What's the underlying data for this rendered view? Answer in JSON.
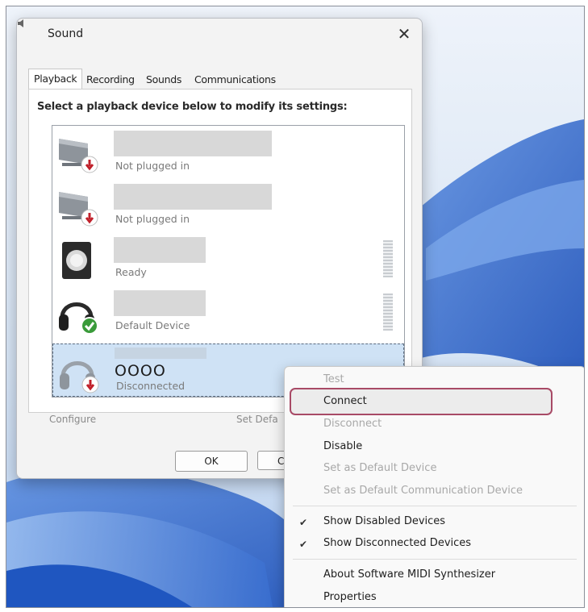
{
  "window": {
    "title": "Sound",
    "close_glyph": "✕"
  },
  "tabs": [
    {
      "label": "Playback",
      "active": true
    },
    {
      "label": "Recording",
      "active": false
    },
    {
      "label": "Sounds",
      "active": false
    },
    {
      "label": "Communications",
      "active": false
    }
  ],
  "instruction": "Select a playback device below to modify its settings:",
  "devices": [
    {
      "name": "",
      "status": "Not plugged in",
      "icon": "speaker-unplugged-icon"
    },
    {
      "name": "",
      "status": "Not plugged in",
      "icon": "speaker-unplugged-icon"
    },
    {
      "name": "",
      "status": "Ready",
      "icon": "speaker-box-icon"
    },
    {
      "name": "",
      "status": "Default Device",
      "icon": "headphones-default-icon"
    },
    {
      "name": "OOOO",
      "status": "Disconnected",
      "icon": "headphones-disconnected-icon"
    }
  ],
  "buttons": {
    "configure": "Configure",
    "set_default": "Set Defa",
    "ok": "OK",
    "cancel": "C"
  },
  "context_menu": {
    "items": [
      {
        "label": "Test",
        "enabled": false
      },
      {
        "label": "Connect",
        "enabled": true,
        "highlighted": true
      },
      {
        "label": "Disconnect",
        "enabled": false
      },
      {
        "label": "Disable",
        "enabled": true
      },
      {
        "label": "Set as Default Device",
        "enabled": false
      },
      {
        "label": "Set as Default Communication Device",
        "enabled": false
      },
      {
        "label": "Show Disabled Devices",
        "enabled": true,
        "checked": true
      },
      {
        "label": "Show Disconnected Devices",
        "enabled": true,
        "checked": true
      },
      {
        "label": "About Software MIDI Synthesizer",
        "enabled": true
      },
      {
        "label": "Properties",
        "enabled": true
      }
    ],
    "check_glyph": "✔"
  },
  "colors": {
    "highlight_border": "#a84a66",
    "selection": "#cfe2f5",
    "wallpaper": "#2f63c4"
  }
}
